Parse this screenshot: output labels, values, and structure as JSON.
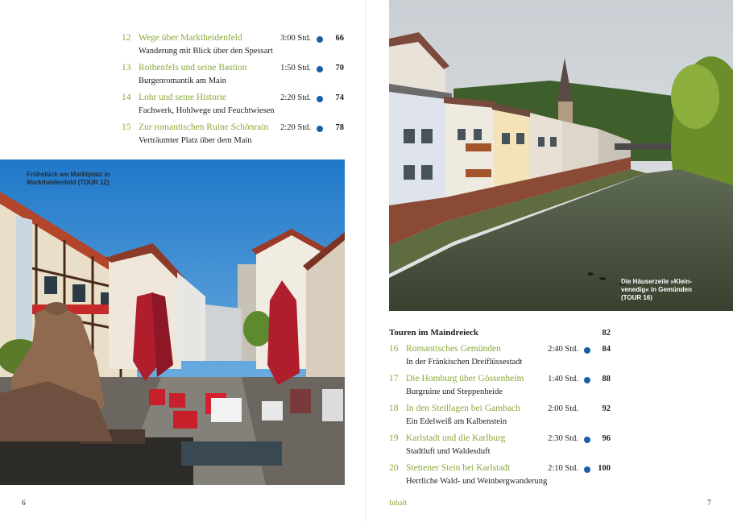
{
  "left_page": {
    "entries": [
      {
        "num": "12",
        "title": "Wege über Marktheidenfeld",
        "time": "3:00 Std.",
        "page": "66",
        "subtitle": "Wanderung mit Blick über den Spessart"
      },
      {
        "num": "13",
        "title": "Rothenfels und seine Bastion",
        "time": "1:50 Std.",
        "page": "70",
        "subtitle": "Burgenromantik am Main"
      },
      {
        "num": "14",
        "title": "Lohr und seine Historie",
        "time": "2:20 Std.",
        "page": "74",
        "subtitle": "Fachwerk, Hohlwege und Feuchtwiesen"
      },
      {
        "num": "15",
        "title": "Zur romantischen Ruine Schönrain",
        "time": "2:20 Std.",
        "page": "78",
        "subtitle": "Verträumter Platz über dem Main"
      }
    ],
    "photo_caption_line1": "Frühstück am Marktplatz in",
    "photo_caption_line2": "Marktheidenfeld (TOUR 12)",
    "folio": "6"
  },
  "right_page": {
    "photo_caption_line1": "Die Häuserzeile »Klein-",
    "photo_caption_line2": "venedig« in Gemünden",
    "photo_caption_line3": "(TOUR 16)",
    "section_title": "Touren im Maindreieck",
    "section_page": "82",
    "entries": [
      {
        "num": "16",
        "title": "Romantisches Gemünden",
        "time": "2:40 Std.",
        "page": "84",
        "subtitle": "In der Fränkischen Dreiflüssestadt"
      },
      {
        "num": "17",
        "title": "Die Homburg über Gössenheim",
        "time": "1:40 Std.",
        "page": "88",
        "subtitle": "Burgruine und Steppenheide"
      },
      {
        "num": "18",
        "title": "In den Steillagen bei Gambach",
        "time": "2:00 Std.",
        "page": "92",
        "subtitle": "Ein Edelweiß am Kalbenstein"
      },
      {
        "num": "19",
        "title": "Karlstadt und die Karlburg",
        "time": "2:30 Std.",
        "page": "96",
        "subtitle": "Stadtluft und Waldesduft"
      },
      {
        "num": "20",
        "title": "Stettener Stein bei Karlstadt",
        "time": "2:10 Std.",
        "page": "100",
        "subtitle": "Herrliche Wald- und Weinbergwanderung"
      }
    ],
    "runner": "Inhalt",
    "folio": "7"
  },
  "colors": {
    "accent_green": "#8aa83a",
    "dot_blue": "#1a5ea6"
  }
}
